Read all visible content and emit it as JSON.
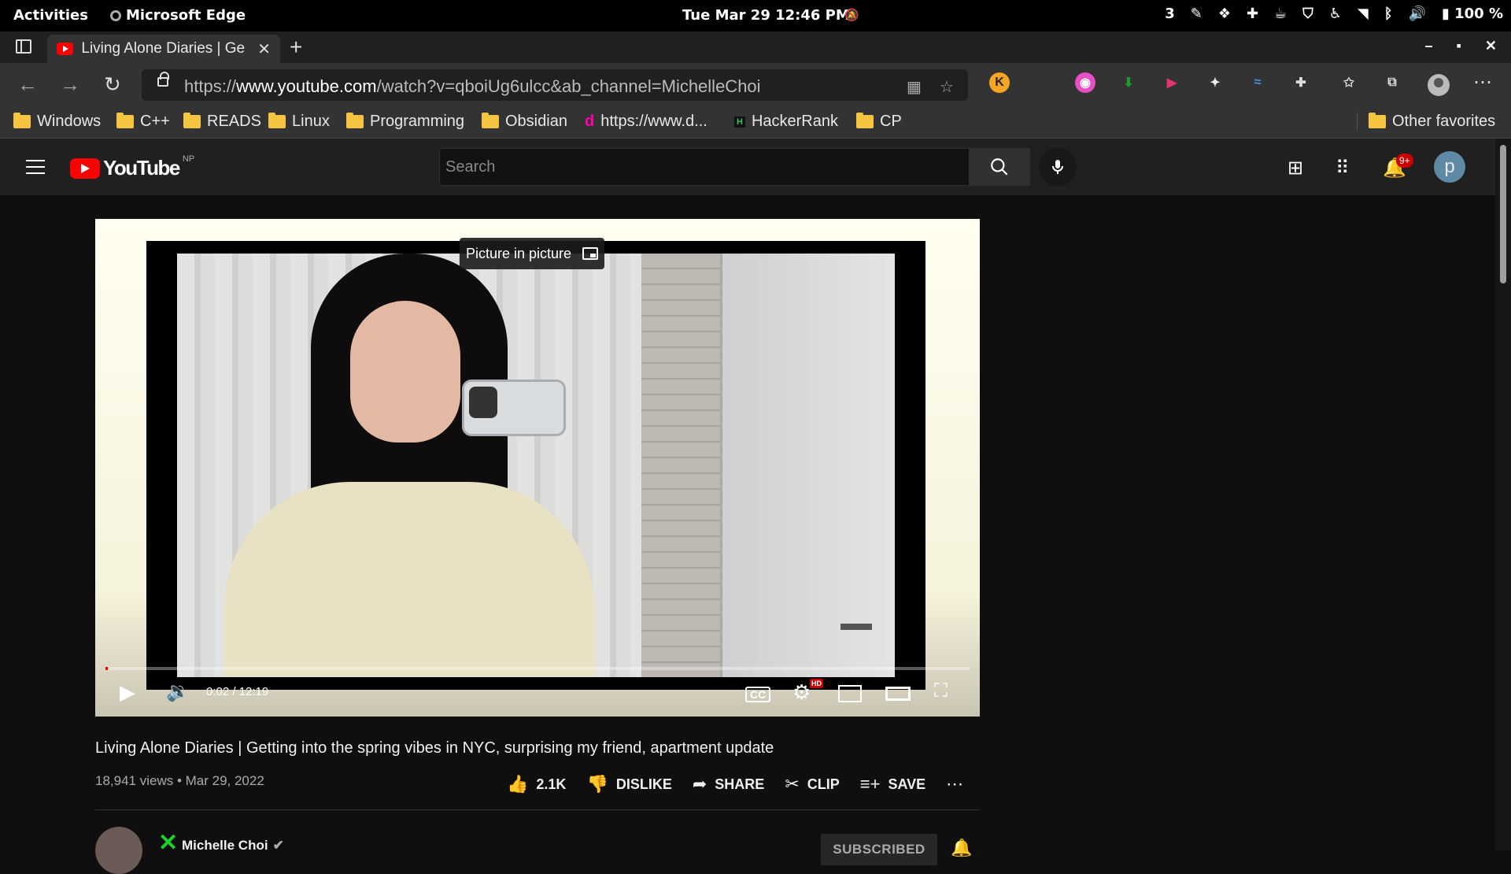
{
  "system": {
    "activities": "Activities",
    "app_name": "Microsoft Edge",
    "clock": "Tue Mar 29  12:46 PM",
    "workspace": "3",
    "battery": "100 %"
  },
  "browser": {
    "tab_title": "Living Alone Diaries | Ge",
    "url_prefix": "https://",
    "url_host": "www.youtube.com",
    "url_path": "/watch?v=qboiUg6ulcc&ab_channel=MichelleChoi",
    "favorites": [
      "Windows",
      "C++",
      "READS",
      "Linux",
      "Programming",
      "Obsidian",
      "https://www.d...",
      "HackerRank",
      "CP"
    ],
    "other_favorites": "Other favorites"
  },
  "youtube": {
    "logo_text": "YouTube",
    "region": "NP",
    "search_placeholder": "Search",
    "notifications_badge": "9+",
    "avatar_letter": "p"
  },
  "player": {
    "tooltip": "Picture in picture",
    "time": "0:02 / 12:19",
    "hd_badge": "HD",
    "progress_fraction": 0.003
  },
  "video": {
    "title": "Living Alone Diaries | Getting into the spring vibes in NYC, surprising my friend, apartment update",
    "views_date": "18,941 views • Mar 29, 2022",
    "like_count": "2.1K",
    "dislike": "DISLIKE",
    "share": "SHARE",
    "clip": "CLIP",
    "save": "SAVE"
  },
  "channel": {
    "name": "Michelle Choi",
    "subscribe_label": "SUBSCRIBED"
  },
  "colors": {
    "youtube_red": "#ff0000",
    "bg": "#0f0f0f",
    "header": "#202020"
  }
}
